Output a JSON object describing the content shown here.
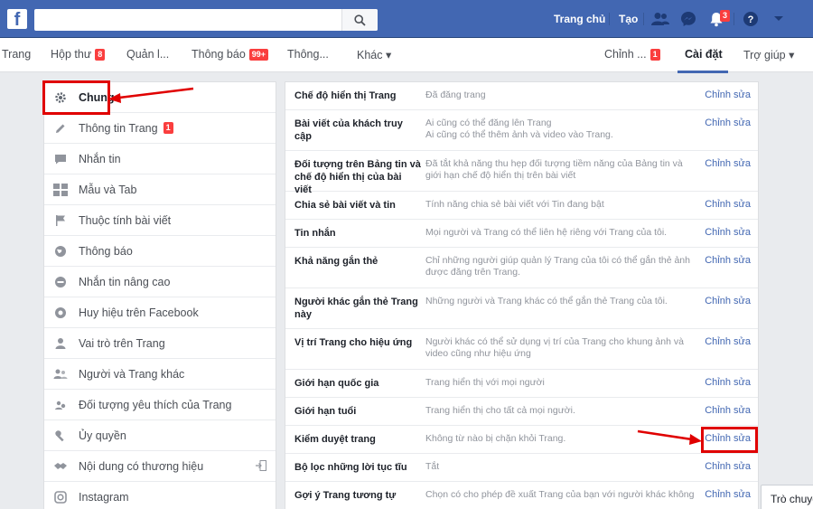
{
  "topbar": {
    "logo": "f",
    "search_placeholder": "",
    "links": [
      "Trang chủ",
      "Tạo"
    ],
    "notifications_badge": "3"
  },
  "page_nav": {
    "items": [
      {
        "label": "Trang"
      },
      {
        "label": "Hộp thư",
        "badge": "8"
      },
      {
        "label": "Quản l..."
      },
      {
        "label": "Thông báo",
        "badge": "99+"
      },
      {
        "label": "Thông..."
      },
      {
        "label": "Khác ▾"
      },
      {
        "label": "Chỉnh ...",
        "badge": "1"
      },
      {
        "label": "Cài đặt"
      },
      {
        "label": "Trợ giúp ▾"
      }
    ]
  },
  "left_menu": {
    "items": [
      {
        "label": "Chung",
        "icon": "gear-icon"
      },
      {
        "label": "Thông tin Trang",
        "icon": "pencil-icon",
        "badge": "1"
      },
      {
        "label": "Nhắn tin",
        "icon": "message-icon"
      },
      {
        "label": "Mẫu và Tab",
        "icon": "grid-icon"
      },
      {
        "label": "Thuộc tính bài viết",
        "icon": "flag-icon"
      },
      {
        "label": "Thông báo",
        "icon": "globe-icon"
      },
      {
        "label": "Nhắn tin nâng cao",
        "icon": "robot-icon"
      },
      {
        "label": "Huy hiệu trên Facebook",
        "icon": "badge-icon"
      },
      {
        "label": "Vai trò trên Trang",
        "icon": "person-icon"
      },
      {
        "label": "Người và Trang khác",
        "icon": "people-icon"
      },
      {
        "label": "Đối tượng yêu thích của Trang",
        "icon": "audience-icon"
      },
      {
        "label": "Ủy quyền",
        "icon": "wrench-icon"
      },
      {
        "label": "Nội dung có thương hiệu",
        "icon": "handshake-icon"
      },
      {
        "label": "Instagram",
        "icon": "instagram-icon"
      }
    ]
  },
  "settings": {
    "edit_label": "Chỉnh sửa",
    "rows": [
      {
        "label": "Chế độ hiển thị Trang",
        "value": "Đã đăng trang"
      },
      {
        "label": "Bài viết của khách truy cập",
        "value": "Ai cũng có thể đăng lên Trang\nAi cũng có thể thêm ảnh và video vào Trang."
      },
      {
        "label": "Đối tượng trên Bảng tin và chế độ hiển thị của bài viết",
        "value": "Đã tắt khả năng thu hẹp đối tượng tiềm năng của Bảng tin và giới hạn chế độ hiển thị trên bài viết"
      },
      {
        "label": "Chia sẻ bài viết và tin",
        "value": "Tính năng chia sẻ bài viết với Tin đang bật"
      },
      {
        "label": "Tin nhắn",
        "value": "Mọi người và Trang có thể liên hệ riêng với Trang của tôi."
      },
      {
        "label": "Khả năng gắn thẻ",
        "value": "Chỉ những người giúp quản lý Trang của tôi có thể gắn thẻ ảnh được đăng trên Trang."
      },
      {
        "label": "Người khác gắn thẻ Trang này",
        "value": "Những người và Trang khác có thể gắn thẻ Trang của tôi."
      },
      {
        "label": "Vị trí Trang cho hiệu ứng",
        "value": "Người khác có thể sử dụng vị trí của Trang cho khung ảnh và video cũng như hiệu ứng"
      },
      {
        "label": "Giới hạn quốc gia",
        "value": "Trang hiển thị với mọi người"
      },
      {
        "label": "Giới hạn tuổi",
        "value": "Trang hiển thị cho tất cả mọi người."
      },
      {
        "label": "Kiểm duyệt trang",
        "value": "Không từ nào bị chặn khỏi Trang."
      },
      {
        "label": "Bộ lọc những lời tục tĩu",
        "value": "Tắt"
      },
      {
        "label": "Gợi ý Trang tương tự",
        "value": "Chọn có cho phép đề xuất Trang của bạn với người khác không"
      }
    ]
  },
  "chat": {
    "label": "Trò chuyện"
  },
  "colors": {
    "brand": "#4267b2",
    "annotation": "#e00000",
    "badge": "#fa3e3e"
  }
}
